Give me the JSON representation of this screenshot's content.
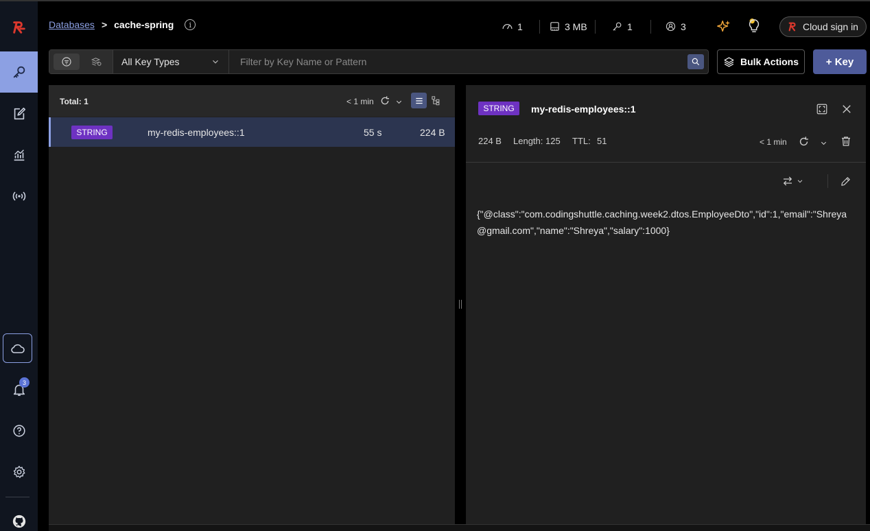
{
  "sidebar": {
    "notification_count": "3"
  },
  "header": {
    "breadcrumb_link": "Databases",
    "breadcrumb_separator": ">",
    "breadcrumb_current": "cache-spring",
    "stats": {
      "ops": "1",
      "memory": "3 MB",
      "keys": "1",
      "clients": "3"
    },
    "cloud_signin_label": "Cloud sign in"
  },
  "toolbar": {
    "key_type_selected": "All Key Types",
    "filter_placeholder": "Filter by Key Name or Pattern",
    "bulk_actions_label": "Bulk Actions",
    "add_key_label": "+ Key"
  },
  "key_list": {
    "total_label": "Total: 1",
    "refresh_time": "< 1 min",
    "rows": [
      {
        "type": "STRING",
        "name": "my-redis-employees::1",
        "ttl": "55 s",
        "size": "224 B"
      }
    ]
  },
  "details": {
    "type": "STRING",
    "key_name": "my-redis-employees::1",
    "size": "224 B",
    "length": "Length: 125",
    "ttl_label": "TTL:",
    "ttl_value": "51",
    "refresh_time": "< 1 min",
    "value": "{\"@class\":\"com.codingshuttle.caching.week2.dtos.EmployeeDto\",\"id\":1,\"email\":\"Shreya@gmail.com\",\"name\":\"Shreya\",\"salary\":1000}"
  },
  "colors": {
    "accent": "#8ca0e3",
    "string_badge": "#6e32c2",
    "brand": "#dc382d"
  }
}
